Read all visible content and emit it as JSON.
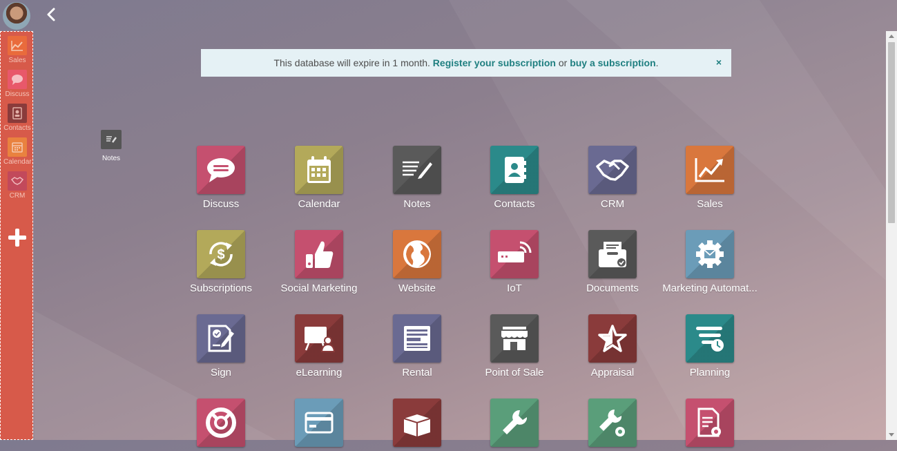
{
  "sidebar": {
    "items": [
      {
        "label": "Sales",
        "icon": "sales-icon",
        "color": "#e96b3c"
      },
      {
        "label": "Discuss",
        "icon": "discuss-icon",
        "color": "#e8586a"
      },
      {
        "label": "Contacts",
        "icon": "contacts-icon",
        "color": "#8a3b3b"
      },
      {
        "label": "Calendar",
        "icon": "calendar-icon",
        "color": "#e9823f"
      },
      {
        "label": "CRM",
        "icon": "crm-icon",
        "color": "#c2495b"
      }
    ]
  },
  "banner": {
    "text": "This database will expire in 1 month.",
    "link1": "Register your subscription",
    "middle": "or",
    "link2": "buy a subscription",
    "end": ".",
    "close": "×"
  },
  "desktop": {
    "note_label": "Notes"
  },
  "apps": [
    {
      "name": "Discuss",
      "color": "#c5506f",
      "icon": "discuss-icon"
    },
    {
      "name": "Calendar",
      "color": "#b3a95a",
      "icon": "calendar-icon"
    },
    {
      "name": "Notes",
      "color": "#5a5a5a",
      "icon": "notes-icon"
    },
    {
      "name": "Contacts",
      "color": "#2b8a8a",
      "icon": "contacts-icon"
    },
    {
      "name": "CRM",
      "color": "#6a6a92",
      "icon": "handshake-icon"
    },
    {
      "name": "Sales",
      "color": "#d9773d",
      "icon": "sales-chart-icon"
    },
    {
      "name": "Subscriptions",
      "color": "#b3a95a",
      "icon": "subscriptions-icon"
    },
    {
      "name": "Social Marketing",
      "color": "#c5506f",
      "icon": "thumbs-up-icon"
    },
    {
      "name": "Website",
      "color": "#d9773d",
      "icon": "globe-icon"
    },
    {
      "name": "IoT",
      "color": "#c5506f",
      "icon": "iot-icon"
    },
    {
      "name": "Documents",
      "color": "#5a5a5a",
      "icon": "documents-icon"
    },
    {
      "name": "Marketing Automat...",
      "color": "#6b9cb8",
      "icon": "gear-mail-icon"
    },
    {
      "name": "Sign",
      "color": "#6a6a92",
      "icon": "sign-icon"
    },
    {
      "name": "eLearning",
      "color": "#8a3b3b",
      "icon": "elearning-icon"
    },
    {
      "name": "Rental",
      "color": "#6a6a92",
      "icon": "rental-icon"
    },
    {
      "name": "Point of Sale",
      "color": "#5a5a5a",
      "icon": "store-icon"
    },
    {
      "name": "Appraisal",
      "color": "#8a3b3b",
      "icon": "star-icon"
    },
    {
      "name": "Planning",
      "color": "#2b8a8a",
      "icon": "planning-icon"
    },
    {
      "name": "",
      "color": "#c5506f",
      "icon": "lifebuoy-icon"
    },
    {
      "name": "",
      "color": "#6b9cb8",
      "icon": "card-icon"
    },
    {
      "name": "",
      "color": "#8a3b3b",
      "icon": "box-icon"
    },
    {
      "name": "",
      "color": "#5a9e7a",
      "icon": "wrench-icon"
    },
    {
      "name": "",
      "color": "#5a9e7a",
      "icon": "wrench-gear-icon"
    },
    {
      "name": "",
      "color": "#c5506f",
      "icon": "report-gear-icon"
    }
  ]
}
